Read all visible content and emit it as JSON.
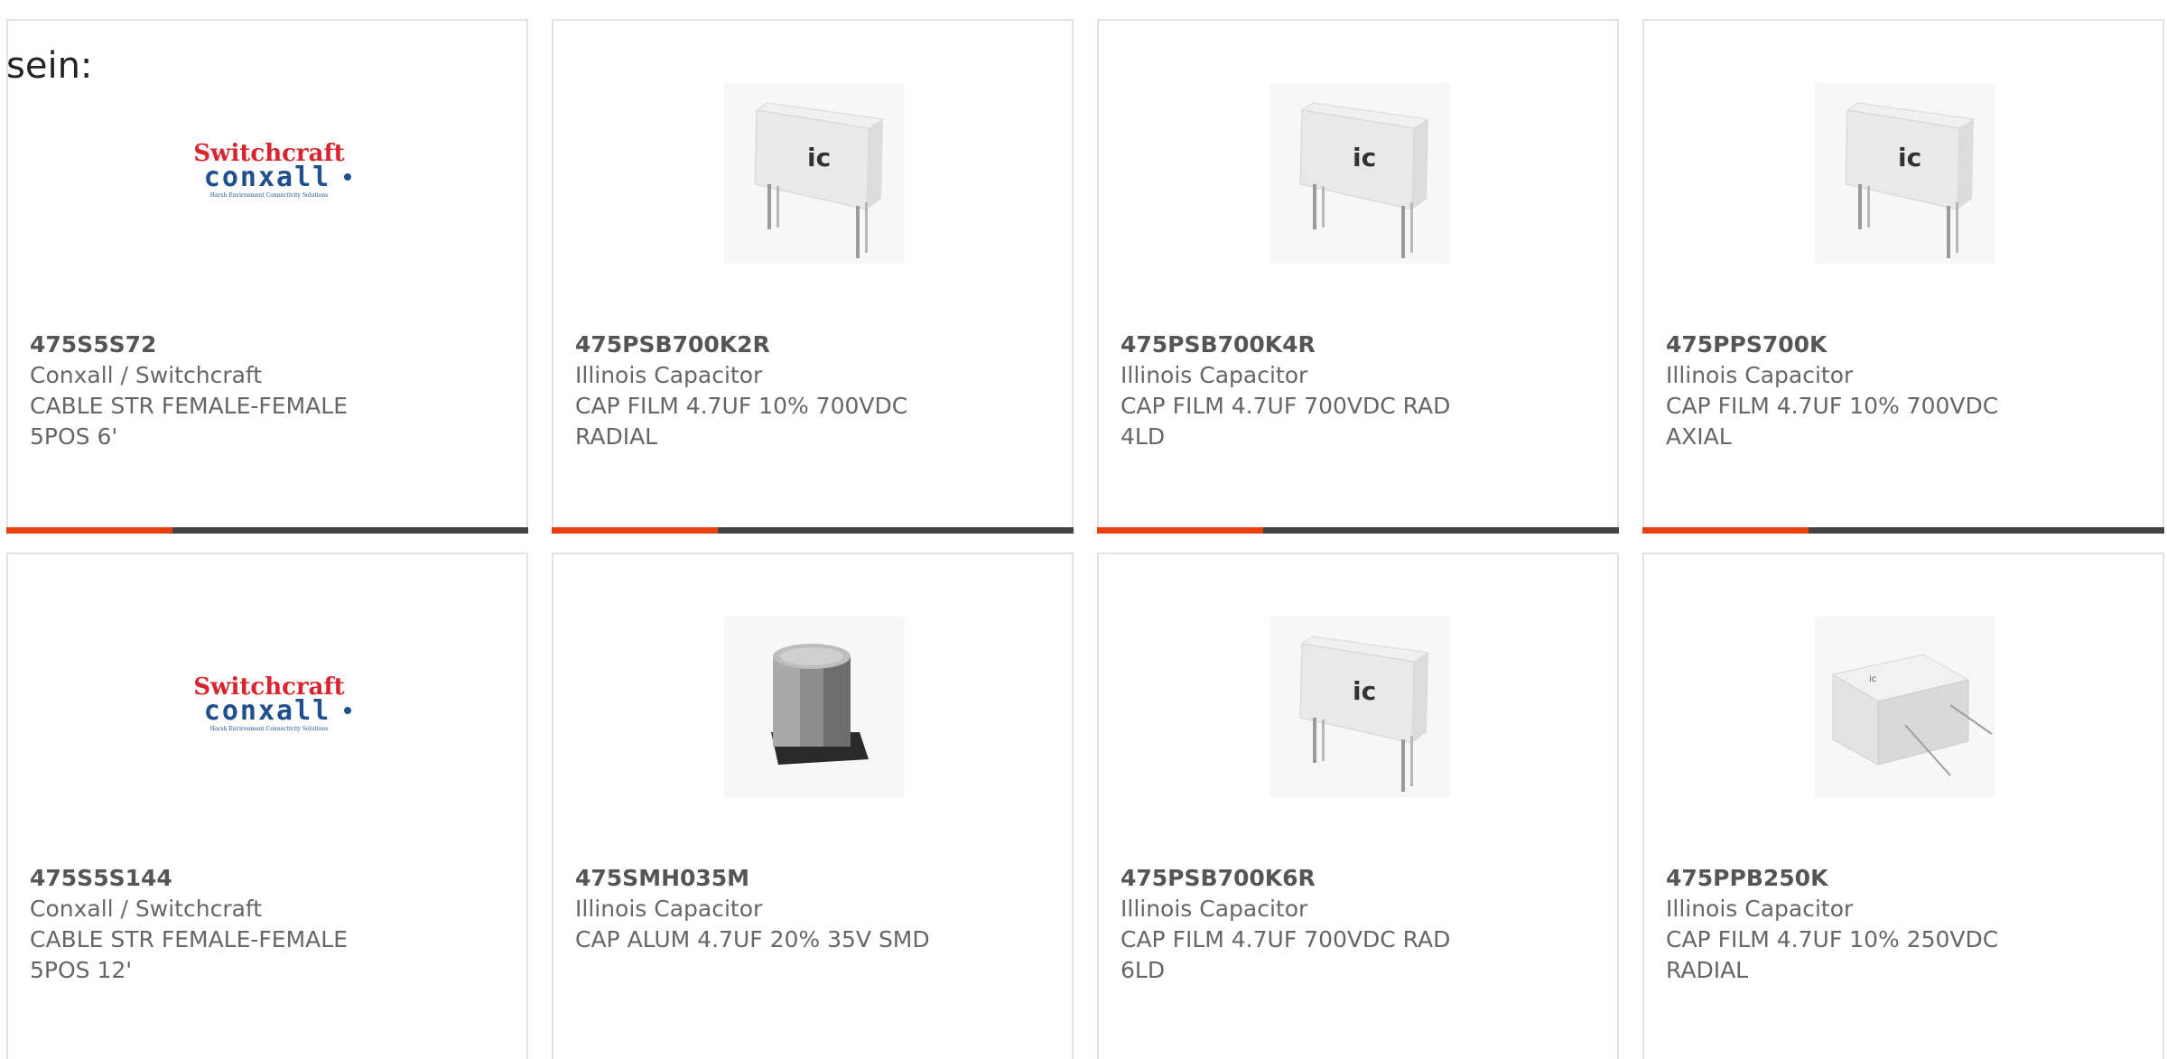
{
  "top_text": "sein:",
  "colors": {
    "accent": "#e8400c",
    "bar": "#444444",
    "border": "#e2e2e2",
    "text": "#666666",
    "switchcraft_red": "#d9232e",
    "conxall_blue": "#1f4f8f"
  },
  "logo": {
    "line1": "Switchcraft",
    "line2": "conxall",
    "tagline": "Harsh Environment Connectivity Solutions"
  },
  "products": [
    {
      "part": "475S5S72",
      "maker": "Conxall / Switchcraft",
      "desc1": "CABLE STR FEMALE-FEMALE",
      "desc2": "5POS 6'",
      "image": "switchcraft-conxall-logo"
    },
    {
      "part": "475PSB700K2R",
      "maker": "Illinois Capacitor",
      "desc1": "CAP FILM 4.7UF 10% 700VDC",
      "desc2": "RADIAL",
      "image": "film-capacitor-radial"
    },
    {
      "part": "475PSB700K4R",
      "maker": "Illinois Capacitor",
      "desc1": "CAP FILM 4.7UF 700VDC RAD",
      "desc2": "4LD",
      "image": "film-capacitor-radial"
    },
    {
      "part": "475PPS700K",
      "maker": "Illinois Capacitor",
      "desc1": "CAP FILM 4.7UF 10% 700VDC",
      "desc2": "AXIAL",
      "image": "film-capacitor-radial"
    },
    {
      "part": "475S5S144",
      "maker": "Conxall / Switchcraft",
      "desc1": "CABLE STR FEMALE-FEMALE",
      "desc2": "5POS 12'",
      "image": "switchcraft-conxall-logo"
    },
    {
      "part": "475SMH035M",
      "maker": "Illinois Capacitor",
      "desc1": "CAP ALUM 4.7UF 20% 35V SMD",
      "desc2": "",
      "image": "aluminum-smd-capacitor"
    },
    {
      "part": "475PSB700K6R",
      "maker": "Illinois Capacitor",
      "desc1": "CAP FILM 4.7UF 700VDC RAD",
      "desc2": "6LD",
      "image": "film-capacitor-radial"
    },
    {
      "part": "475PPB250K",
      "maker": "Illinois Capacitor",
      "desc1": "CAP FILM 4.7UF 10% 250VDC",
      "desc2": "RADIAL",
      "image": "box-film-capacitor"
    }
  ]
}
